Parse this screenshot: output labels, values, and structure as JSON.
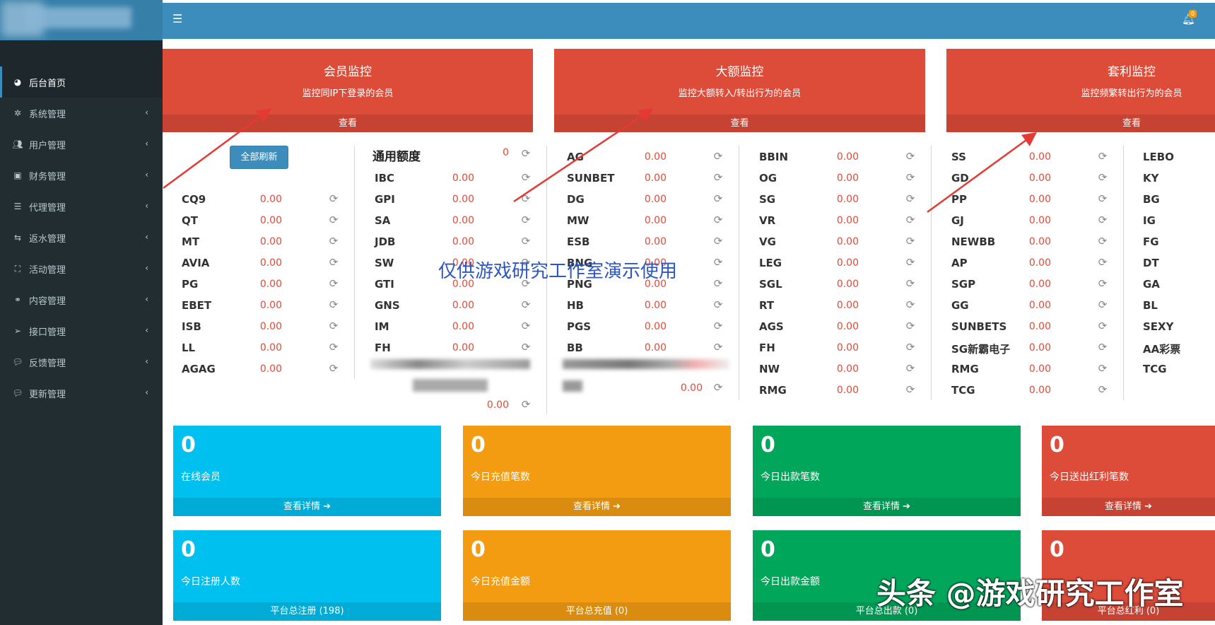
{
  "sidebar": {
    "items": [
      {
        "label": "后台首页",
        "icon": "dashboard-icon",
        "active": true
      },
      {
        "label": "系统管理",
        "icon": "gear-icon"
      },
      {
        "label": "用户管理",
        "icon": "users-icon"
      },
      {
        "label": "财务管理",
        "icon": "money-icon"
      },
      {
        "label": "代理管理",
        "icon": "list-icon"
      },
      {
        "label": "返水管理",
        "icon": "exchange-icon"
      },
      {
        "label": "活动管理",
        "icon": "map-icon"
      },
      {
        "label": "内容管理",
        "icon": "link-icon"
      },
      {
        "label": "接口管理",
        "icon": "send-icon"
      },
      {
        "label": "反馈管理",
        "icon": "comment-icon"
      },
      {
        "label": "更新管理",
        "icon": "comment-icon"
      }
    ]
  },
  "header": {
    "menu_icon": "hamburger-icon",
    "bell_icon": "bell-icon",
    "notification_count": "0"
  },
  "monitors": [
    {
      "title": "会员监控",
      "subtitle": "监控同IP下登录的会员",
      "link": "查看"
    },
    {
      "title": "大额监控",
      "subtitle": "监控大额转入/转出行为的会员",
      "link": "查看"
    },
    {
      "title": "套利监控",
      "subtitle": "监控频繁转出行为的会员",
      "link": "查看"
    }
  ],
  "refresh_all": "全部刷新",
  "quota": {
    "title": "通用额度",
    "value": "0"
  },
  "platform_columns": [
    [
      {
        "name": "CQ9",
        "value": "0.00"
      },
      {
        "name": "QT",
        "value": "0.00"
      },
      {
        "name": "MT",
        "value": "0.00"
      },
      {
        "name": "AVIA",
        "value": "0.00"
      },
      {
        "name": "PG",
        "value": "0.00"
      },
      {
        "name": "EBET",
        "value": "0.00"
      },
      {
        "name": "ISB",
        "value": "0.00"
      },
      {
        "name": "LL",
        "value": "0.00"
      },
      {
        "name": "AGAG",
        "value": "0.00"
      }
    ],
    [
      {
        "name": "IBC",
        "value": "0.00"
      },
      {
        "name": "GPI",
        "value": "0.00"
      },
      {
        "name": "SA",
        "value": "0.00"
      },
      {
        "name": "JDB",
        "value": "0.00"
      },
      {
        "name": "SW",
        "value": "0.00"
      },
      {
        "name": "GTI",
        "value": "0.00"
      },
      {
        "name": "GNS",
        "value": "0.00"
      },
      {
        "name": "IM",
        "value": "0.00"
      },
      {
        "name": "FH",
        "value": "0.00"
      }
    ],
    [
      {
        "name": "AG",
        "value": "0.00"
      },
      {
        "name": "SUNBET",
        "value": "0.00"
      },
      {
        "name": "DG",
        "value": "0.00"
      },
      {
        "name": "MW",
        "value": "0.00"
      },
      {
        "name": "ESB",
        "value": "0.00"
      },
      {
        "name": "BNG",
        "value": "0.00"
      },
      {
        "name": "PNG",
        "value": "0.00"
      },
      {
        "name": "HB",
        "value": "0.00"
      },
      {
        "name": "PGS",
        "value": "0.00"
      },
      {
        "name": "BB",
        "value": "0.00"
      }
    ],
    [
      {
        "name": "BBIN",
        "value": "0.00"
      },
      {
        "name": "OG",
        "value": "0.00"
      },
      {
        "name": "SG",
        "value": "0.00"
      },
      {
        "name": "VR",
        "value": "0.00"
      },
      {
        "name": "VG",
        "value": "0.00"
      },
      {
        "name": "LEG",
        "value": "0.00"
      },
      {
        "name": "SGL",
        "value": "0.00"
      },
      {
        "name": "RT",
        "value": "0.00"
      },
      {
        "name": "AGS",
        "value": "0.00"
      },
      {
        "name": "FH",
        "value": "0.00"
      },
      {
        "name": "NW",
        "value": "0.00"
      },
      {
        "name": "RMG",
        "value": "0.00"
      }
    ],
    [
      {
        "name": "SS",
        "value": "0.00"
      },
      {
        "name": "GD",
        "value": "0.00"
      },
      {
        "name": "PP",
        "value": "0.00"
      },
      {
        "name": "GJ",
        "value": "0.00"
      },
      {
        "name": "NEWBB",
        "value": "0.00"
      },
      {
        "name": "AP",
        "value": "0.00"
      },
      {
        "name": "SGP",
        "value": "0.00"
      },
      {
        "name": "GG",
        "value": "0.00"
      },
      {
        "name": "SUNBETS",
        "value": "0.00"
      },
      {
        "name": "SG新霸电子",
        "value": "0.00"
      },
      {
        "name": "RMG",
        "value": "0.00"
      },
      {
        "name": "TCG",
        "value": "0.00"
      }
    ],
    [
      {
        "name": "LEBO"
      },
      {
        "name": "KY"
      },
      {
        "name": "BG"
      },
      {
        "name": "IG"
      },
      {
        "name": "FG"
      },
      {
        "name": "DT"
      },
      {
        "name": "GA"
      },
      {
        "name": "BL"
      },
      {
        "name": "SEXY"
      },
      {
        "name": "AA彩票"
      },
      {
        "name": "TCG"
      }
    ]
  ],
  "extra_values": {
    "col2_extra": "0.00",
    "col3_extra": "0.00"
  },
  "stats_row1": [
    {
      "value": "0",
      "label": "在线会员",
      "footer": "查看详情 ➔",
      "color": "#00c0ef"
    },
    {
      "value": "0",
      "label": "今日充值笔数",
      "footer": "查看详情 ➔",
      "color": "#f39c12"
    },
    {
      "value": "0",
      "label": "今日出款笔数",
      "footer": "查看详情 ➔",
      "color": "#00a65a"
    },
    {
      "value": "0",
      "label": "今日送出红利笔数",
      "footer": "查看详情 ➔",
      "color": "#dd4b39"
    }
  ],
  "stats_row2": [
    {
      "value": "0",
      "label": "今日注册人数",
      "footer": "平台总注册 (198)",
      "color": "#00c0ef"
    },
    {
      "value": "0",
      "label": "今日充值金额",
      "footer": "平台总充值 (0)",
      "color": "#f39c12"
    },
    {
      "value": "0",
      "label": "今日出款金额",
      "footer": "平台总出款 (0)",
      "color": "#00a65a"
    },
    {
      "value": "0",
      "label": "",
      "footer": "平台总红利 (0)",
      "color": "#dd4b39"
    }
  ],
  "watermarks": {
    "center": "仅供游戏研究工作室演示使用",
    "corner": "头条 @游戏研究工作室"
  }
}
